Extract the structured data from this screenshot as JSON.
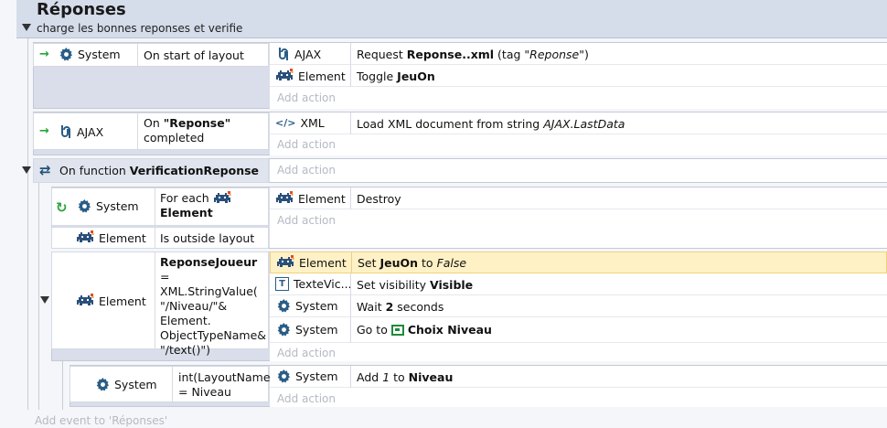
{
  "group": {
    "title": "Réponses",
    "description": "charge les bonnes reponses et verifie"
  },
  "events": {
    "e1": {
      "cond_object": "System",
      "cond_text": "On start of layout",
      "actions": [
        {
          "object": "AJAX",
          "pre": "Request ",
          "bold": "Reponse..xml",
          "mid": " (tag \"",
          "ital": "Reponse",
          "post": "\")"
        },
        {
          "object": "Element",
          "pre": "Toggle ",
          "bold": "JeuOn"
        }
      ],
      "add_action": "Add action"
    },
    "e2": {
      "cond_object": "AJAX",
      "cond_pre": "On ",
      "cond_bold": "\"Reponse\"",
      "cond_post": "completed",
      "actions": [
        {
          "object": "XML",
          "pre": "Load XML document from string ",
          "ital": "AJAX.LastData"
        }
      ],
      "add_action": "Add action"
    },
    "func": {
      "pre": "On function ",
      "bold": "VerificationReponse",
      "add_action": "Add action"
    },
    "e3": {
      "cond1_object": "System",
      "cond1_pre": "For each",
      "cond1_bold": "Element",
      "cond2_object": "Element",
      "cond2_text": "Is outside layout",
      "actions": [
        {
          "object": "Element",
          "pre": "Destroy"
        }
      ],
      "add_action": "Add action"
    },
    "e4": {
      "cond_object": "Element",
      "cond_bold": "ReponseJoueur",
      "cond_lines": [
        " =",
        "XML.StringValue(",
        "\"/Niveau/\"&",
        "Element.",
        "ObjectTypeName&",
        "\"/text()\")"
      ],
      "actions": [
        {
          "object": "Element",
          "pre": "Set ",
          "bold": "JeuOn",
          "mid": " to ",
          "ital": "False"
        },
        {
          "object": "TexteVic...",
          "pre": "Set visibility ",
          "bold": "Visible"
        },
        {
          "object": "System",
          "pre": "Wait ",
          "bold": "2",
          "post": " seconds"
        },
        {
          "object": "System",
          "pre": "Go to ",
          "bold": "Choix Niveau"
        }
      ],
      "add_action": "Add action"
    },
    "e5": {
      "cond_object": "System",
      "cond_line1": "int(LayoutName)",
      "cond_line2": "= Niveau",
      "actions": [
        {
          "object": "System",
          "pre": "Add ",
          "ital": "1",
          "mid": " to ",
          "bold": "Niveau"
        }
      ],
      "add_action": "Add action"
    }
  },
  "footer": {
    "add_event": "Add event to 'Réponses'"
  },
  "colors": {
    "group_bg": "#d5dcea",
    "panel_bg": "#d9deea",
    "highlight": "#fff1c6",
    "trigger_green": "#2aa43a"
  },
  "icons": [
    "gear-icon",
    "ajax-icon",
    "xml-icon",
    "sprite-icon",
    "text-icon",
    "function-icon",
    "trigger-arrow-icon",
    "loop-icon",
    "layout-icon",
    "collapse-triangle-icon"
  ]
}
